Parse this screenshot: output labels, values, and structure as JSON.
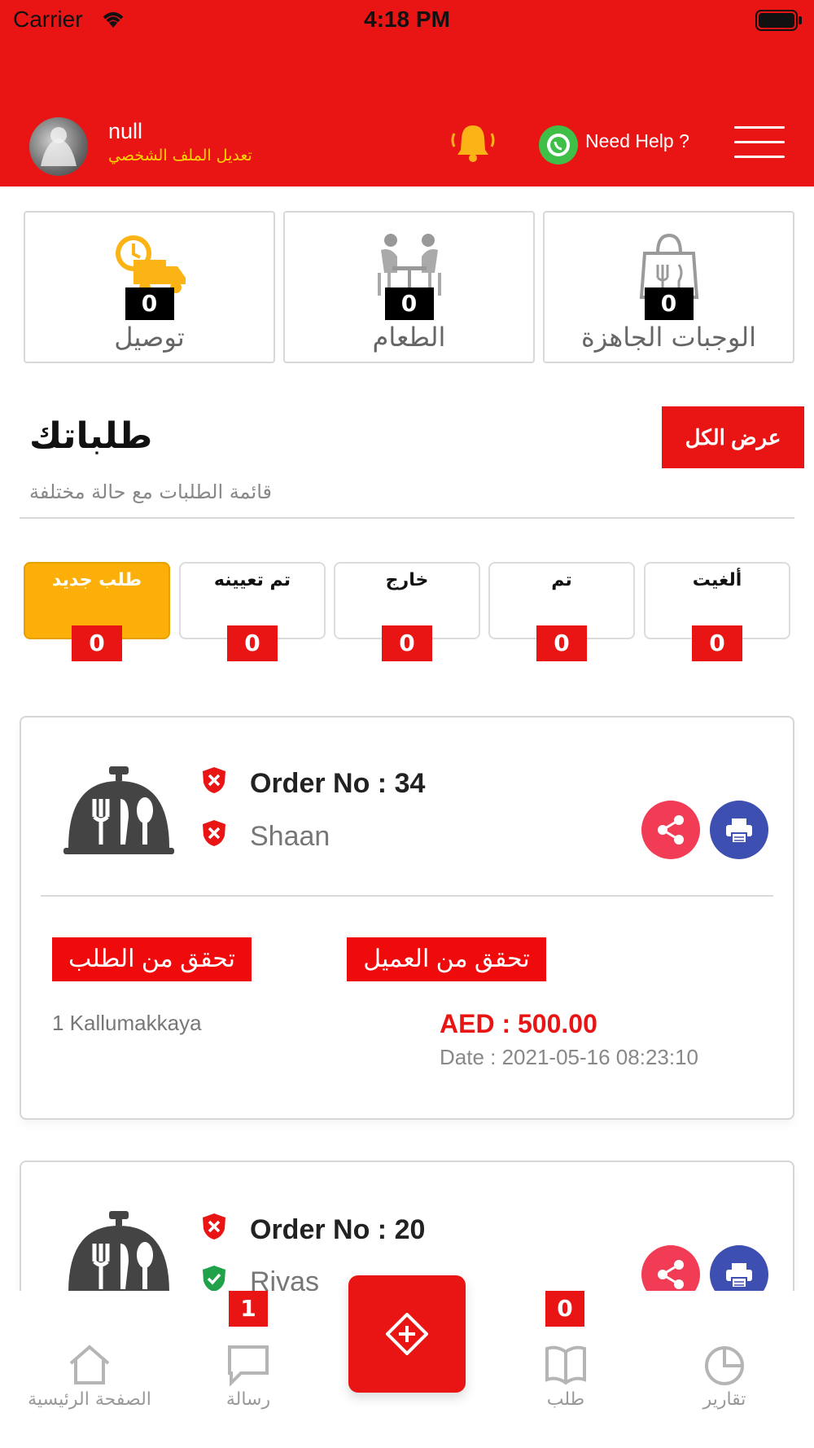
{
  "status_bar": {
    "carrier": "Carrier",
    "time": "4:18 PM"
  },
  "header": {
    "profile_name": "null",
    "edit_profile": "تعديل الملف الشخصي",
    "help": "Need Help ?"
  },
  "stats": [
    {
      "label": "توصيل",
      "count": "0",
      "icon": "delivery-truck-icon"
    },
    {
      "label": "الطعام",
      "count": "0",
      "icon": "dine-in-icon"
    },
    {
      "label": "الوجبات الجاهزة",
      "count": "0",
      "icon": "takeaway-bag-icon"
    }
  ],
  "orders_section": {
    "title": "طلباتك",
    "subtitle": "قائمة الطلبات مع حالة مختلفة",
    "view_all": "عرض الكل"
  },
  "tabs": [
    {
      "label": "طلب جديد",
      "count": "0",
      "active": true
    },
    {
      "label": "تم تعيينه",
      "count": "0"
    },
    {
      "label": "خارج",
      "count": "0"
    },
    {
      "label": "تم",
      "count": "0"
    },
    {
      "label": "ألغيت",
      "count": "0"
    }
  ],
  "orders": [
    {
      "order_no": "Order No : 34",
      "customer": "Shaan",
      "check_order": "تحقق من الطلب",
      "check_customer": "تحقق من العميل",
      "items": "1  Kallumakkaya",
      "amount": "AED : 500.00",
      "date": "Date : 2021-05-16 08:23:10"
    },
    {
      "order_no": "Order No : 20",
      "customer": "Rivas"
    }
  ],
  "bottom_nav": {
    "home": "الصفحة الرئيسية",
    "messages": "رسالة",
    "messages_badge": "1",
    "orders": "طلب",
    "orders_badge": "0",
    "reports": "تقارير"
  },
  "colors": {
    "primary": "#e91515",
    "accent": "#fbaf08",
    "share": "#f23c55",
    "print": "#3e4fb2"
  }
}
